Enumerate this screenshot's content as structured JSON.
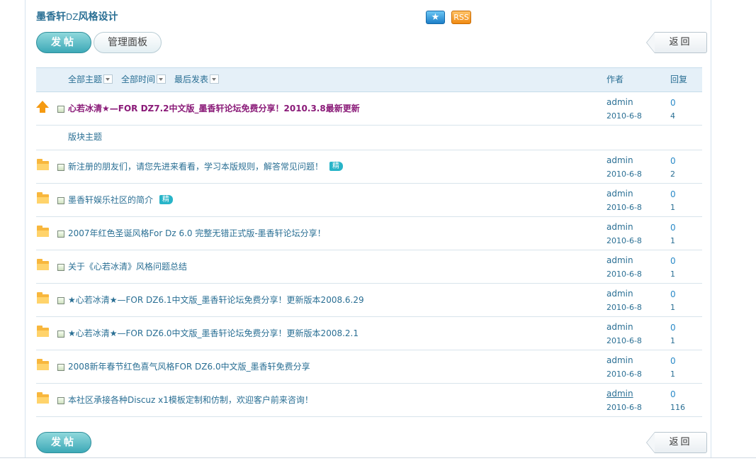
{
  "forum": {
    "title_prefix": "墨香轩",
    "title_dz": "DZ",
    "title_suffix": "风格设计"
  },
  "icons": {
    "star": "★",
    "rss": "RSS"
  },
  "toolbar": {
    "post_label": "发帖",
    "manage_label": "管理面板",
    "back_label": "返回"
  },
  "table": {
    "filters": [
      "全部主题",
      "全部时间",
      "最后发表"
    ],
    "header_author": "作者",
    "header_reply": "回复",
    "section_label": "版块主题",
    "sticky": {
      "title": "心若冰清★—FOR DZ7.2中文版_墨香轩论坛免费分享！2010.3.8最新更新",
      "author": "admin",
      "date": "2010-6-8",
      "replies": "0",
      "views": "4"
    },
    "threads": [
      {
        "title": "新注册的朋友们，请您先进来看看，学习本版规则，解答常见问题！",
        "badge": "精",
        "author": "admin",
        "date": "2010-6-8",
        "replies": "0",
        "views": "2"
      },
      {
        "title": "墨香轩娱乐社区的简介",
        "badge": "精",
        "author": "admin",
        "date": "2010-6-8",
        "replies": "0",
        "views": "1"
      },
      {
        "title": "2007年红色圣诞风格For Dz 6.0 完整无错正式版-墨香轩论坛分享！",
        "author": "admin",
        "date": "2010-6-8",
        "replies": "0",
        "views": "1"
      },
      {
        "title": "关于《心若冰清》风格问题总结",
        "author": "admin",
        "date": "2010-6-8",
        "replies": "0",
        "views": "1"
      },
      {
        "title": "★心若冰清★—FOR DZ6.1中文版_墨香轩论坛免费分享！更新版本2008.6.29",
        "author": "admin",
        "date": "2010-6-8",
        "replies": "0",
        "views": "1"
      },
      {
        "title": "★心若冰清★—FOR DZ6.0中文版_墨香轩论坛免费分享！更新版本2008.2.1",
        "author": "admin",
        "date": "2010-6-8",
        "replies": "0",
        "views": "1"
      },
      {
        "title": "2008新年春节红色喜气风格FOR DZ6.0中文版_墨香轩免费分享",
        "author": "admin",
        "date": "2010-6-8",
        "replies": "0",
        "views": "1"
      },
      {
        "title": "本社区承接各种Discuz x1模板定制和仿制，欢迎客户前来咨询！",
        "author": "admin",
        "date": "2010-6-8",
        "replies": "0",
        "views": "116"
      }
    ]
  }
}
